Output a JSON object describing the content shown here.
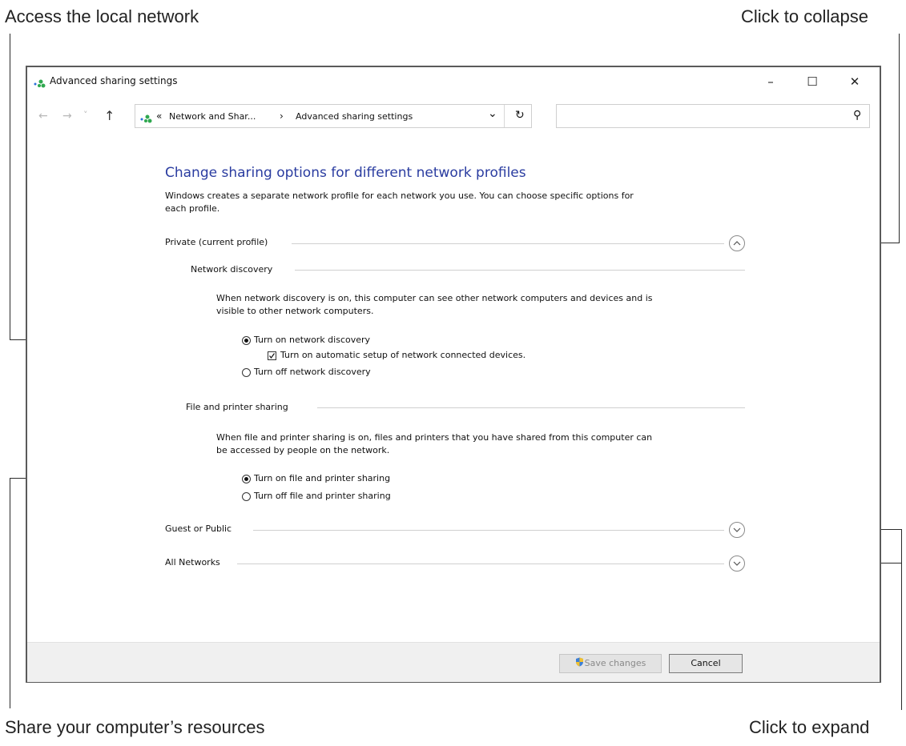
{
  "callouts": {
    "top_left": "Access the local network",
    "top_right": "Click to collapse",
    "bottom_left": "Share your computer’s resources",
    "bottom_right": "Click to expand"
  },
  "window": {
    "title": "Advanced sharing settings",
    "controls": {
      "minimize": "–",
      "maximize": "☐",
      "close": "✕"
    }
  },
  "nav": {
    "back": "←",
    "forward": "→",
    "recent": "˅",
    "up": "↑",
    "address_prefix": "«",
    "breadcrumb_parent": "Network and Shar...",
    "breadcrumb_sep": "›",
    "breadcrumb_current": "Advanced sharing settings",
    "dropdown": "⌄",
    "refresh": "↻",
    "search_icon": "⚲",
    "search_value": ""
  },
  "content": {
    "heading": "Change sharing options for different network profiles",
    "intro_line1": "Windows creates a separate network profile for each network you use. You can choose specific options for",
    "intro_line2": "each profile.",
    "private_label": "Private (current profile)",
    "network_discovery": {
      "label": "Network discovery",
      "desc_line1": "When network discovery is on, this computer can see other network computers and devices and is",
      "desc_line2": "visible to other network computers.",
      "opt_on": "Turn on network discovery",
      "opt_auto": "Turn on automatic setup of network connected devices.",
      "opt_off": "Turn off network discovery",
      "selected": "on",
      "auto_checked": true
    },
    "file_printer": {
      "label": "File and printer sharing",
      "desc_line1": "When file and printer sharing is on, files and printers that you have shared from this computer can",
      "desc_line2": "be accessed by people on the network.",
      "opt_on": "Turn on file and printer sharing",
      "opt_off": "Turn off file and printer sharing",
      "selected": "on"
    },
    "guest_label": "Guest or Public",
    "all_label": "All Networks"
  },
  "footer": {
    "save_label": "Save changes",
    "cancel_label": "Cancel",
    "save_enabled": false
  },
  "colors": {
    "heading": "#2a3ca0",
    "footer_bg": "#f0f0f0",
    "rule": "#d0d0d0"
  }
}
